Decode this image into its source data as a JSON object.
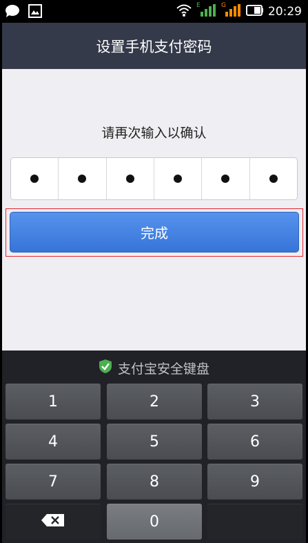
{
  "status_bar": {
    "time": "20:29",
    "sim1_label": "E",
    "sim2_label": "G"
  },
  "header": {
    "title": "设置手机支付密码"
  },
  "prompt": "请再次输入以确认",
  "password": {
    "filled_count": 6,
    "length": 6,
    "mask_char": "●"
  },
  "done_button": {
    "label": "完成"
  },
  "keyboard": {
    "title": "支付宝安全键盘",
    "keys": [
      "1",
      "2",
      "3",
      "4",
      "5",
      "6",
      "7",
      "8",
      "9",
      "",
      "0",
      ""
    ]
  },
  "colors": {
    "title_bar": "#343a4a",
    "done_button": "#4584e5",
    "highlight_outline": "#e3262f",
    "keyboard_bg": "#202227",
    "shield_green": "#4caf50"
  }
}
